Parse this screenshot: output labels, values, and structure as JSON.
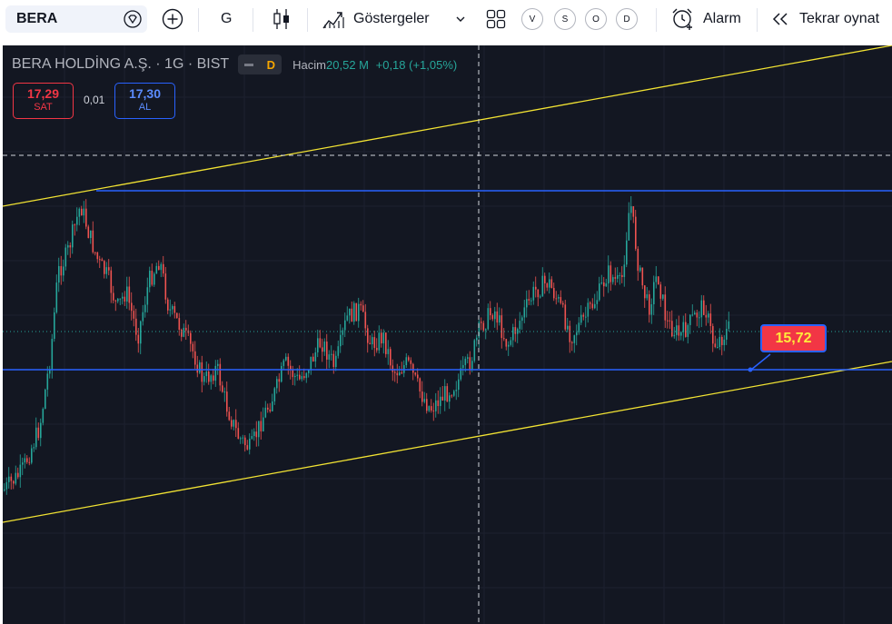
{
  "toolbar": {
    "symbol": "BERA",
    "interval": "G",
    "indicators_label": "Göstergeler",
    "alarm_label": "Alarm",
    "replay_label": "Tekrar oynat",
    "circle_buttons": [
      "V",
      "S",
      "O",
      "D"
    ]
  },
  "legend": {
    "title": "BERA HOLDİNG A.Ş. · 1G · BIST",
    "badge": "D",
    "volume_label": "Hacim",
    "volume_value": "20,52 M",
    "change": "+0,18 (+1,05%)"
  },
  "trade": {
    "sell_price": "17,29",
    "sell_label": "SAT",
    "spread": "0,01",
    "buy_price": "17,30",
    "buy_label": "AL"
  },
  "chart_data": {
    "type": "candlestick",
    "symbol": "BERA",
    "interval": "1G",
    "annotations": {
      "price_label": "15,72"
    },
    "colors": {
      "up": "#26a69a",
      "down": "#ef5350",
      "trendline": "#f2e333",
      "horizontal": "#2962ff",
      "background": "#131722"
    }
  }
}
